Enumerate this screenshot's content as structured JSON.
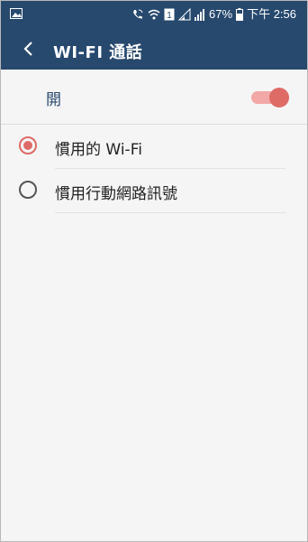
{
  "status_bar": {
    "battery": "67%",
    "time": "下午 2:56",
    "sim_badge": "1",
    "icons": [
      "image-icon",
      "wifi-calling-icon",
      "wifi-icon",
      "sim-icon",
      "signal-icon",
      "signal-icon-2",
      "battery-icon"
    ]
  },
  "app_bar": {
    "title": "WI-FI 通話",
    "back_icon": "chevron-left-icon"
  },
  "master": {
    "label": "開",
    "enabled": true
  },
  "options": [
    {
      "label": "慣用的 Wi-Fi",
      "selected": true
    },
    {
      "label": "慣用行動網路訊號",
      "selected": false
    }
  ],
  "colors": {
    "header_bg": "#27496e",
    "accent": "#de6b66",
    "toggle_track": "#f2a8a6",
    "label_blue": "#2a4a6d"
  }
}
